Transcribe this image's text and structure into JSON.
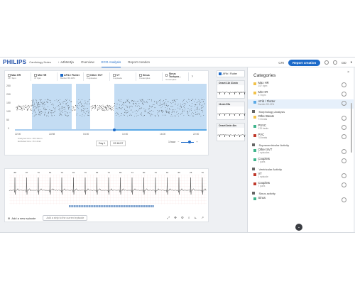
{
  "header": {
    "logo": "PHILIPS",
    "app_name": "Cardiology Notes",
    "patient": "a4b9e3ja",
    "tabs": [
      "Overview",
      "ECG Analysis",
      "Report creation"
    ],
    "active_tab": "ECG Analysis",
    "cri_label": "CRI",
    "report_button": "Report creation",
    "user": "DD"
  },
  "strip": {
    "categories": [
      {
        "name": "Max HR",
        "sub": "157 bpm",
        "checked": false
      },
      {
        "name": "Min HR",
        "sub": "47 bpm",
        "checked": false
      },
      {
        "name": "AFib / Flutter",
        "sub": "Burden 59.19%",
        "checked": true
      },
      {
        "name": "Other SVT",
        "sub": "2 episodes",
        "checked": false
      },
      {
        "name": "VT",
        "sub": "1 episode",
        "checked": false
      },
      {
        "name": "Sinus",
        "sub": "3 examples",
        "checked": false
      },
      {
        "name": "Sinus Tachyca...",
        "sub": "4 examples",
        "checked": false
      }
    ],
    "y_ticks": [
      "250",
      "200",
      "150",
      "100",
      "50",
      "0"
    ],
    "x_ticks": [
      "22:00",
      "22/08",
      "04:00",
      "10:00",
      "16:00",
      "22:00"
    ],
    "notes": [
      "Analyzed time: 18h 34min",
      "Excluded time: 1h 14min"
    ],
    "day_label": "Day 1",
    "time_value": "22:18:57",
    "zoom_label": "1 hour"
  },
  "ecg": {
    "hr_labels": [
      "88",
      "87",
      "79",
      "81",
      "79",
      "81",
      "79",
      "84",
      "79",
      "83",
      "74",
      "90",
      "79",
      "81",
      "85",
      "78",
      "79"
    ],
    "add_episode": "Add a new episode",
    "add_strip": "Add a strip to the current episode"
  },
  "episode_tab": "AFib / Flutter",
  "episodes": [
    {
      "title": "Onset 11h 31min"
    },
    {
      "title": "11min 55s"
    },
    {
      "title": "Onset 2min 4ks"
    }
  ],
  "sidebar": {
    "title": "Categories",
    "items_top": [
      {
        "label": "Max HR",
        "sub": "157 bpm",
        "color": "#f2c24a"
      },
      {
        "label": "Min HR",
        "sub": "47 bpm",
        "color": "#f2c24a"
      },
      {
        "label": "AFib / Flutter",
        "sub": "Burden 59.19%",
        "color": "#5aa9e6",
        "selected": true
      }
    ],
    "sections": [
      {
        "title": "Morphology Analysis",
        "items": [
          {
            "label": "Other Beats",
            "sub": "74 beats",
            "color": "#f2c24a"
          },
          {
            "label": "PSVC",
            "sub": "133 beats",
            "color": "#3fb48c"
          },
          {
            "label": "PVC",
            "sub": "78 beats",
            "color": "#c0392b"
          }
        ]
      },
      {
        "title": "Supraventricular Activity",
        "items": [
          {
            "label": "Other SVT",
            "sub": "2 episodes",
            "color": "#3fb48c"
          },
          {
            "label": "Couplets",
            "sub": "7 pairs",
            "color": "#3fb48c"
          }
        ]
      },
      {
        "title": "Ventricular Activity",
        "items": [
          {
            "label": "VT",
            "sub": "1 episode",
            "color": "#c0392b"
          },
          {
            "label": "Couplets",
            "sub": "7 pairs",
            "color": "#c0392b"
          }
        ]
      },
      {
        "title": "Sinus activity",
        "items": [
          {
            "label": "Sinus",
            "sub": "",
            "color": "#3fb48c"
          }
        ]
      }
    ]
  },
  "colors": {
    "accent": "#1c6ac9",
    "afib_band": "#a9cdee"
  }
}
